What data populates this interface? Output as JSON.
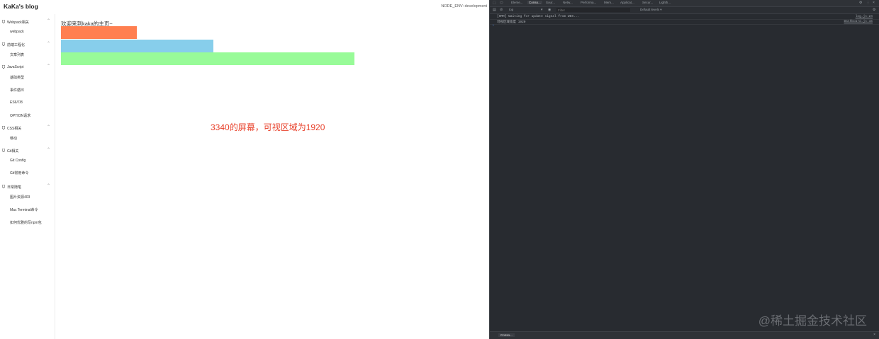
{
  "app": {
    "brand": "KaKa's blog",
    "env": "NODE_ENV: development",
    "sidebar": [
      {
        "title": "Webpack相关",
        "items": [
          "webpack"
        ]
      },
      {
        "title": "前端工程化",
        "items": [
          "文章列表"
        ]
      },
      {
        "title": "JavaScript",
        "items": [
          "基础类型",
          "事件循环",
          "ES6/7/8",
          "OPTION请求"
        ]
      },
      {
        "title": "CSS相关",
        "items": [
          "移动"
        ]
      },
      {
        "title": "Git相关",
        "items": [
          "Git Config",
          "Git常用命令"
        ]
      },
      {
        "title": "日常随笔",
        "items": [
          "图片资源403",
          "Mac Terminal命令",
          "如何优雅的写npm包"
        ]
      }
    ],
    "welcome": "欢迎来到kaka的主页~",
    "caption": "3340的屏幕，可视区域为1920"
  },
  "devtools": {
    "tabs": [
      "Eleme...",
      "Conso...",
      "Sour...",
      "Netw...",
      "Performa...",
      "Mem...",
      "Applicat...",
      "Secur...",
      "Lighth..."
    ],
    "active_tab": 1,
    "toolbar": {
      "context": "top",
      "filter_placeholder": "Filter",
      "levels": "Default levels ▾"
    },
    "console_lines": [
      {
        "message": "[HMR] Waiting for update signal from WDS...",
        "source": "log.js:24"
      },
      {
        "message": "可视区域宽度    1920",
        "source": "Dashboard.js:15"
      }
    ],
    "prompt": "›",
    "drawer_tab": "Conso...",
    "drawer_close": "×"
  },
  "watermark": "@稀土掘金技术社区",
  "colors": {
    "orange": "#ff7f50",
    "blue": "#87ceeb",
    "green": "#98fb98",
    "caption": "#e8402a",
    "devtools_bg": "#282b30"
  }
}
